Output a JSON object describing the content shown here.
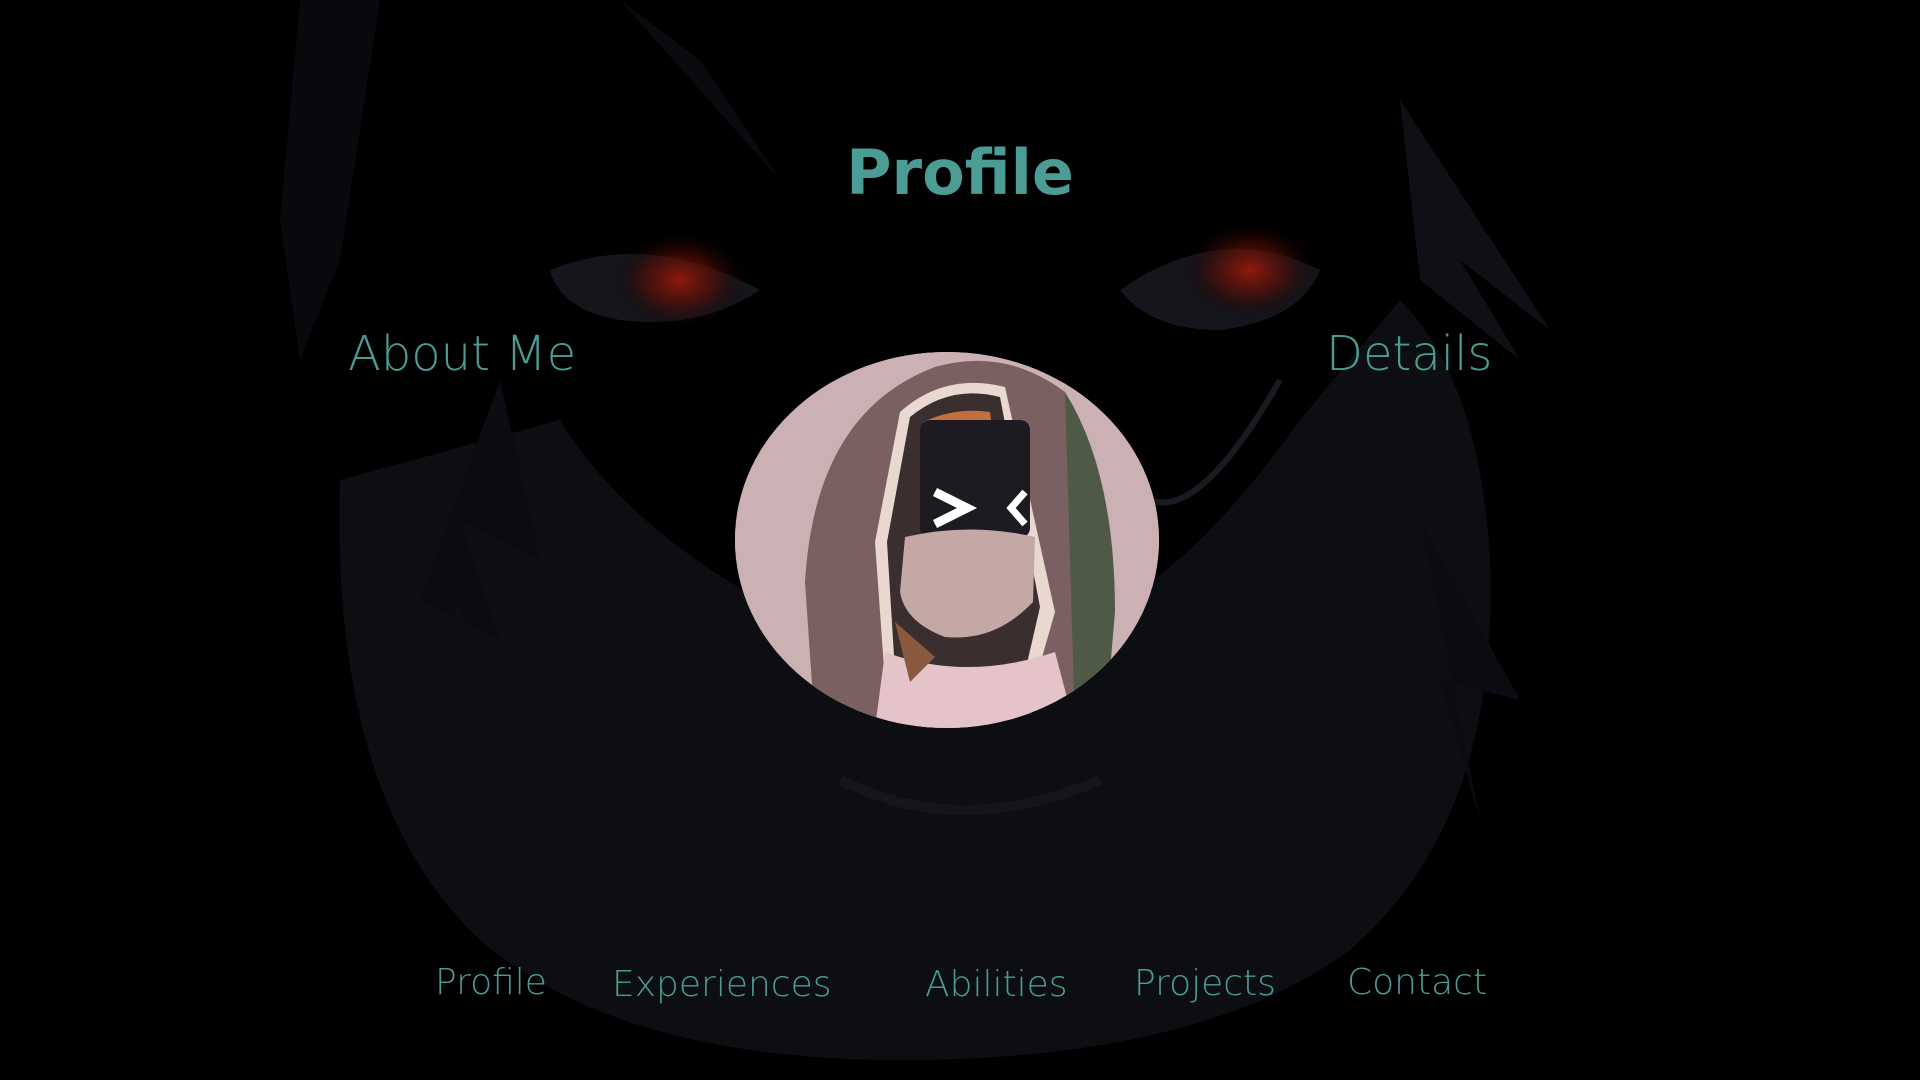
{
  "page": {
    "title": "Profile"
  },
  "sections": {
    "about_label": "About Me",
    "details_label": "Details"
  },
  "avatar": {
    "alt_icon": "hooded-masked-avatar"
  },
  "nav": {
    "items": [
      {
        "label": "Profile"
      },
      {
        "label": "Experiences"
      },
      {
        "label": "Abilities"
      },
      {
        "label": "Projects"
      },
      {
        "label": "Contact"
      }
    ]
  },
  "colors": {
    "accent": "#4a9c95",
    "background": "#000000"
  }
}
